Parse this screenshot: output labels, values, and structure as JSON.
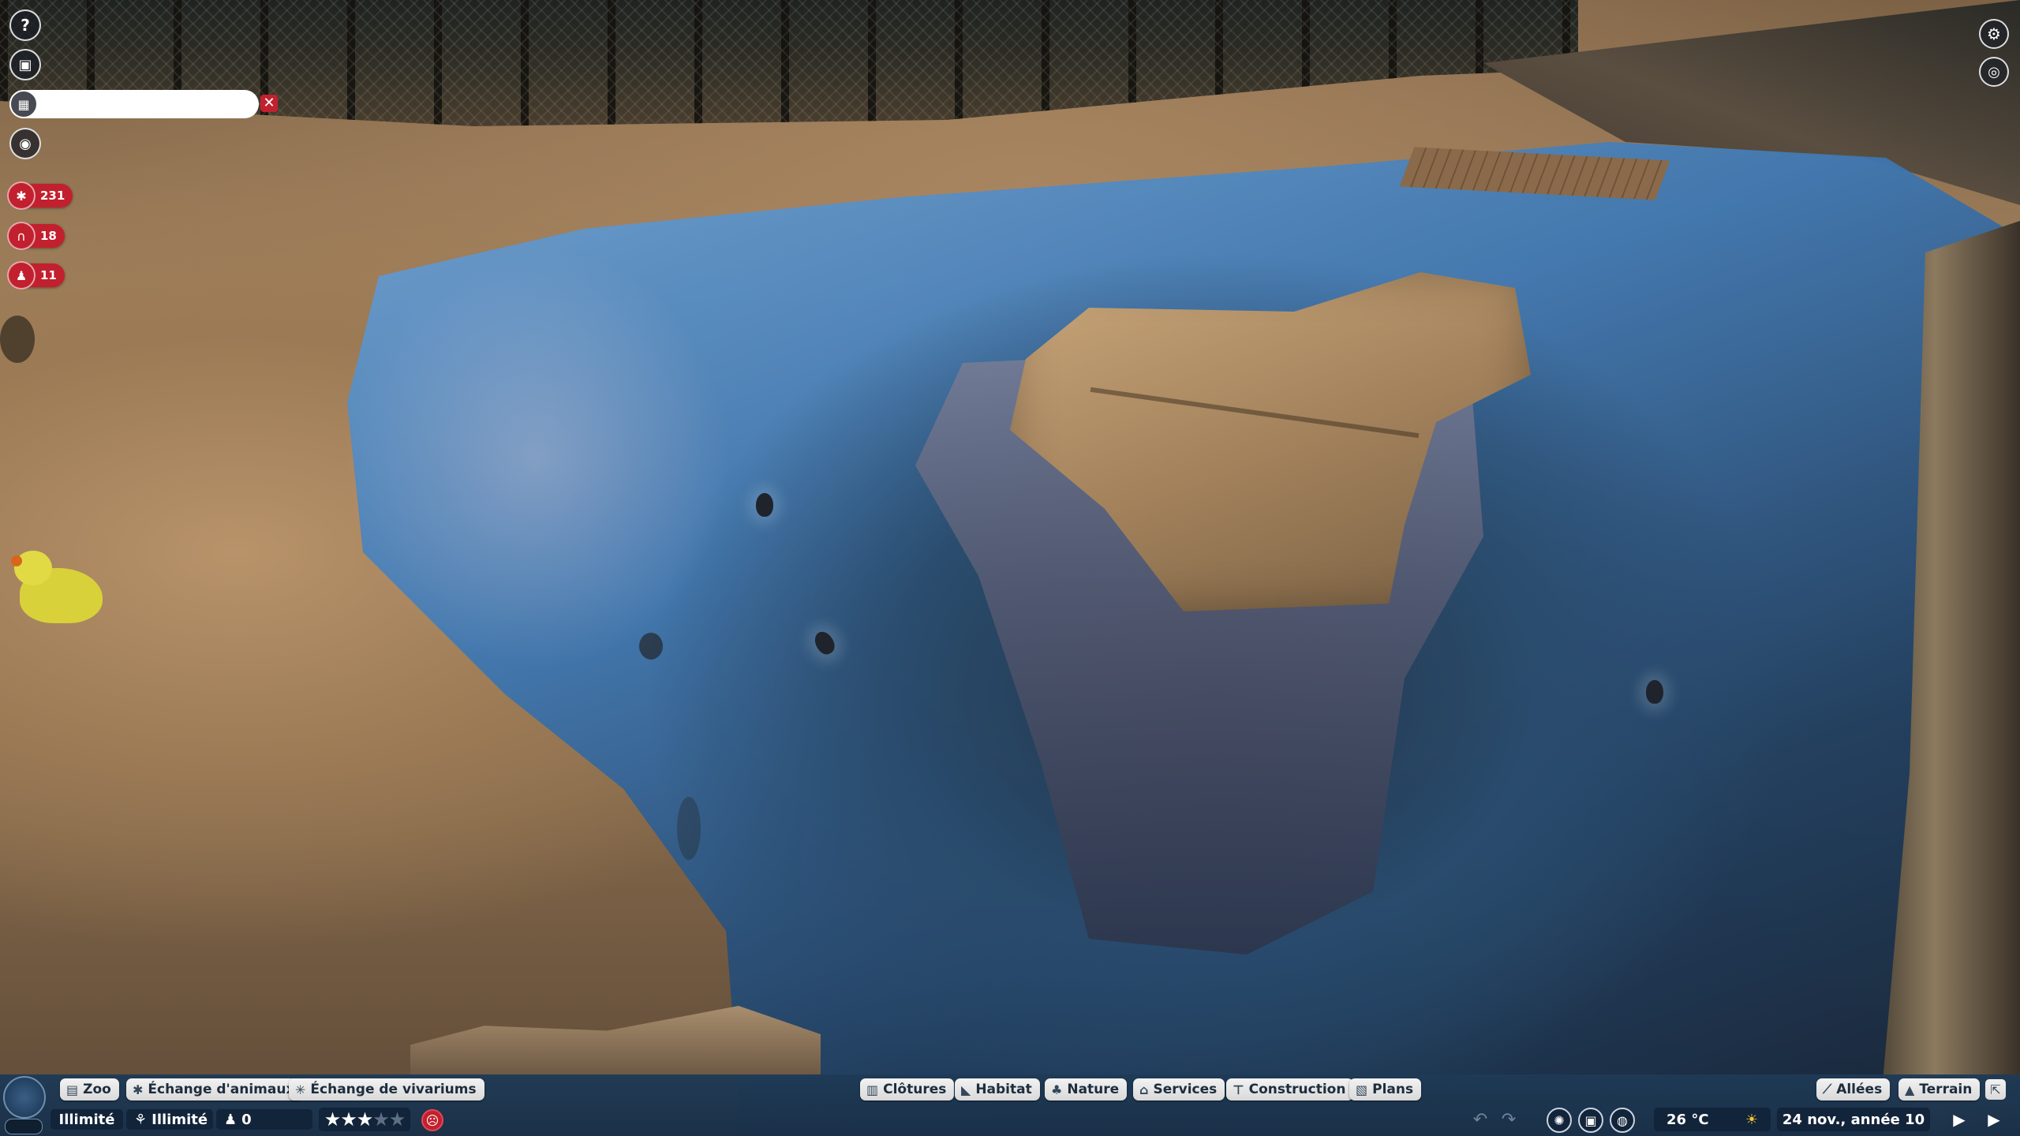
{
  "game": {
    "title": ""
  },
  "left_hud": {
    "help_label": "?",
    "search": {
      "value": "",
      "placeholder": ""
    },
    "clear_label": "✕",
    "stats": [
      {
        "icon": "paw-icon",
        "value": "231"
      },
      {
        "icon": "guest-arch-icon",
        "value": "18"
      },
      {
        "icon": "staff-icon",
        "value": "11"
      }
    ]
  },
  "bottom_bar": {
    "left_tabs": [
      {
        "icon": "zoo-icon",
        "label": "Zoo"
      },
      {
        "icon": "paw-icon",
        "label": "Échange d'animaux"
      },
      {
        "icon": "bug-icon",
        "label": "Échange de vivariums"
      }
    ],
    "center_tabs": [
      {
        "icon": "fence-icon",
        "label": "Clôtures"
      },
      {
        "icon": "habitat-icon",
        "label": "Habitat"
      },
      {
        "icon": "tree-icon",
        "label": "Nature"
      },
      {
        "icon": "shop-icon",
        "label": "Services"
      },
      {
        "icon": "construction-icon",
        "label": "Construction"
      },
      {
        "icon": "blueprint-icon",
        "label": "Plans"
      }
    ],
    "right_tabs": [
      {
        "icon": "path-icon",
        "label": "Allées"
      },
      {
        "icon": "terrain-icon",
        "label": "Terrain"
      }
    ],
    "money": "Illimité",
    "research": "Illimité",
    "guests": "0",
    "rating_stars": 3,
    "rating_max": 5,
    "temperature": "26 °C",
    "date": "24 nov., année 10"
  },
  "colors": {
    "accent_red": "#c2202e",
    "bar_blue": "#1e3a56",
    "pill_dark": "#12243a"
  }
}
